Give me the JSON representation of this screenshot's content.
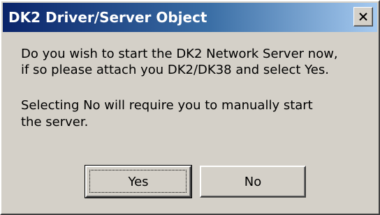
{
  "window": {
    "title": "DK2 Driver/Server Object",
    "close_icon": "close-icon"
  },
  "message": {
    "line1": "Do you wish to start the DK2 Network Server now,",
    "line2": "if so please attach you DK2/DK38 and select Yes.",
    "line3": "Selecting No will require you to manually start",
    "line4": "the server."
  },
  "buttons": {
    "yes_label": "Yes",
    "no_label": "No"
  },
  "colors": {
    "title_bar_start": "#0a246a",
    "title_bar_end": "#a6caf0",
    "dialog_face": "#d4d0c8"
  }
}
